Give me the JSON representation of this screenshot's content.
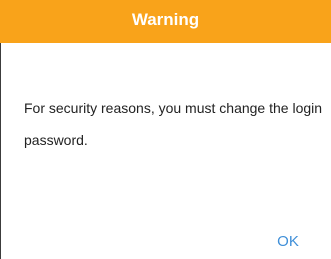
{
  "dialog": {
    "title": "Warning",
    "message": "For security reasons, you must change the login password.",
    "ok_label": "OK"
  },
  "colors": {
    "header_background": "#f9a31a",
    "header_text": "#ffffff",
    "message_text": "#222222",
    "ok_text": "#3f8fd8"
  }
}
